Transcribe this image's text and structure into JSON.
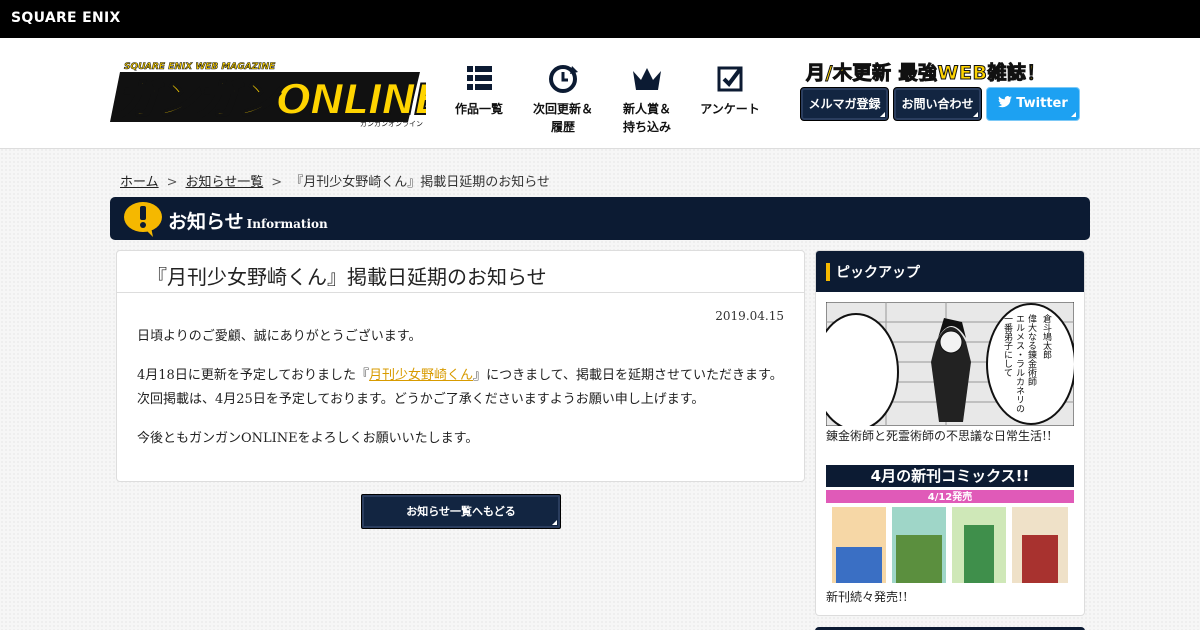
{
  "topbar": {
    "brand": "SQUARE ENIX"
  },
  "header": {
    "logo_alt": "ガンガンONLINE",
    "nav": [
      {
        "label": "作品一覧",
        "icon": "grid-list-icon"
      },
      {
        "label": "次回更新＆履歴",
        "icon": "clock-refresh-icon"
      },
      {
        "label": "新人賞＆持ち込み",
        "icon": "crown-icon"
      },
      {
        "label": "アンケート",
        "icon": "checkbox-icon"
      }
    ],
    "tagline": "月/木更新 最強WEB雑誌！",
    "buttons": {
      "mailmag": "メルマガ登録",
      "contact": "お問い合わせ",
      "twitter": "Twitter"
    }
  },
  "breadcrumb": {
    "home": "ホーム",
    "news": "お知らせ一覧",
    "current": "『月刊少女野崎くん』掲載日延期のお知らせ",
    "sep": ">"
  },
  "section": {
    "title": "お知らせ",
    "subtitle": "Information"
  },
  "article": {
    "title": "『月刊少女野崎くん』掲載日延期のお知らせ",
    "date": "2019.04.15",
    "p1": "日頃よりのご愛顧、誠にありがとうございます。",
    "p2_pre": "4月18日に更新を予定しておりました『",
    "p2_link": "月刊少女野崎くん",
    "p2_post": "』につきまして、掲載日を延期させていただきます。次回掲載は、4月25日を予定しております。どうかご了承くださいますようお願い申し上げます。",
    "p3": "今後ともガンガンONLINEをよろしくお願いいたします。"
  },
  "back_button": "お知らせ一覧へもどる",
  "sidebar": {
    "title": "ピックアップ",
    "items": [
      {
        "caption": "錬金術師と死霊術師の不思議な日常生活!!",
        "bubble_right": "偉大なる錬金術師 エルメス・ラルカネリの 一番弟子にして",
        "bubble_name": "倉斗鳩太郎"
      },
      {
        "caption": "新刊続々発売!!",
        "banner_title": "4月の新刊コミックス!!",
        "banner_date": "4/12発売"
      }
    ]
  },
  "colors": {
    "navy": "#0c1b33",
    "accent": "#f5b800",
    "link": "#d89b00",
    "twitter": "#1da1f2"
  }
}
